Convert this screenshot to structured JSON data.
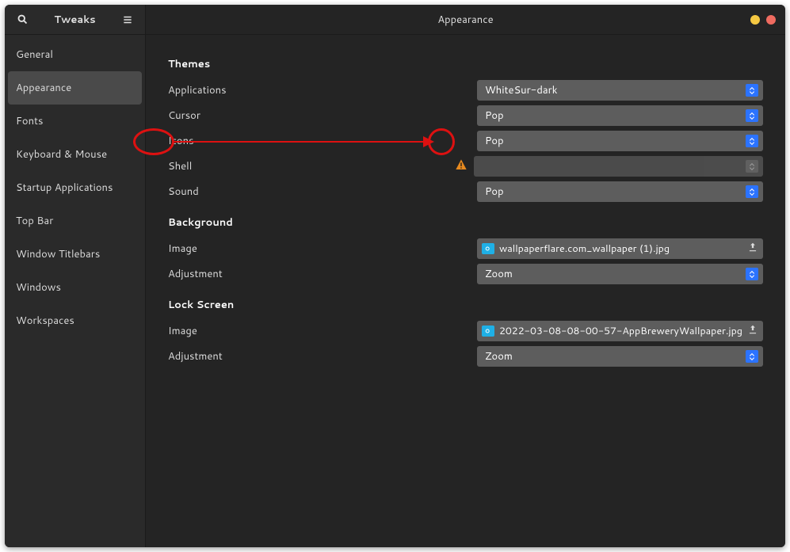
{
  "app_title": "Tweaks",
  "page_title": "Appearance",
  "sidebar": {
    "items": [
      {
        "label": "General"
      },
      {
        "label": "Appearance",
        "active": true
      },
      {
        "label": "Fonts"
      },
      {
        "label": "Keyboard & Mouse"
      },
      {
        "label": "Startup Applications"
      },
      {
        "label": "Top Bar"
      },
      {
        "label": "Window Titlebars"
      },
      {
        "label": "Windows"
      },
      {
        "label": "Workspaces"
      }
    ]
  },
  "themes": {
    "section": "Themes",
    "applications": {
      "label": "Applications",
      "value": "WhiteSur-dark"
    },
    "cursor": {
      "label": "Cursor",
      "value": "Pop"
    },
    "icons": {
      "label": "Icons",
      "value": "Pop"
    },
    "shell": {
      "label": "Shell",
      "value": "",
      "disabled": true,
      "warning": true
    },
    "sound": {
      "label": "Sound",
      "value": "Pop"
    }
  },
  "background": {
    "section": "Background",
    "image": {
      "label": "Image",
      "value": "wallpaperflare.com_wallpaper (1).jpg"
    },
    "adjustment": {
      "label": "Adjustment",
      "value": "Zoom"
    }
  },
  "lockscreen": {
    "section": "Lock Screen",
    "image": {
      "label": "Image",
      "value": "2022-03-08-08-00-57-AppBreweryWallpaper.jpg"
    },
    "adjustment": {
      "label": "Adjustment",
      "value": "Zoom"
    }
  }
}
